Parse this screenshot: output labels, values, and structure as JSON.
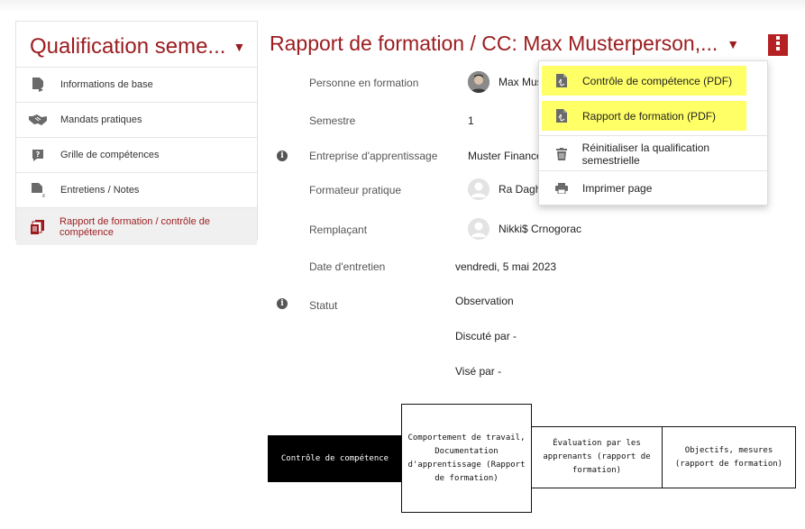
{
  "sidebar": {
    "title": "Qualification seme...",
    "caret": "▼",
    "items": [
      {
        "label": "Informations de base",
        "icon": "document-arrow-icon"
      },
      {
        "label": "Mandats pratiques",
        "icon": "handshake-icon"
      },
      {
        "label": "Grille de compétences",
        "icon": "question-chat-icon"
      },
      {
        "label": "Entretiens / Notes",
        "icon": "document-edit-icon"
      },
      {
        "label": "Rapport de formation / contrôle de compétence",
        "icon": "reports-stack-icon"
      }
    ]
  },
  "main": {
    "title": "Rapport de formation / CC: Max Musterperson,...",
    "caret": "▼",
    "menu_icon": "vertical-menu-icon"
  },
  "details": {
    "person_label": "Personne en formation",
    "person_value": "Max Mus",
    "semester_label": "Semestre",
    "semester_value": "1",
    "company_label": "Entreprise d'apprentissage",
    "company_value": "Muster Finance :",
    "trainer_label": "Formateur pratique",
    "trainer_value": "Ra Daghe",
    "substitute_label": "Remplaçant",
    "substitute_value": "Nikki$ Crnogorac",
    "date_label": "Date d'entretien",
    "date_value": "vendredi, 5 mai 2023",
    "status_label": "Statut",
    "status_value": "Observation",
    "discussed_value": "Discuté par -",
    "signed_value": "Visé par -"
  },
  "dropdown": {
    "items": [
      {
        "label": "Contrôle de compétence (PDF)",
        "icon": "pdf-file-icon",
        "highlighted": true
      },
      {
        "label": "Rapport de formation (PDF)",
        "icon": "pdf-file-icon",
        "highlighted": true
      },
      {
        "label": "Réinitialiser la qualification semestrielle",
        "icon": "trash-icon",
        "highlighted": false
      },
      {
        "label": "Imprimer page",
        "icon": "printer-icon",
        "highlighted": false
      }
    ]
  },
  "boxes": [
    {
      "text": "Contrôle de compétence",
      "style": "dark"
    },
    {
      "text": "Comportement de travail, Documentation d'apprentissage (Rapport de formation)",
      "style": "light"
    },
    {
      "text": "Évaluation par les apprenants (rapport de formation)",
      "style": "light"
    },
    {
      "text": "Objectifs, mesures (rapport de formation)",
      "style": "light"
    }
  ],
  "colors": {
    "accent": "#9b1c1f",
    "menu_button": "#b52023",
    "highlight": "#ffff66"
  }
}
